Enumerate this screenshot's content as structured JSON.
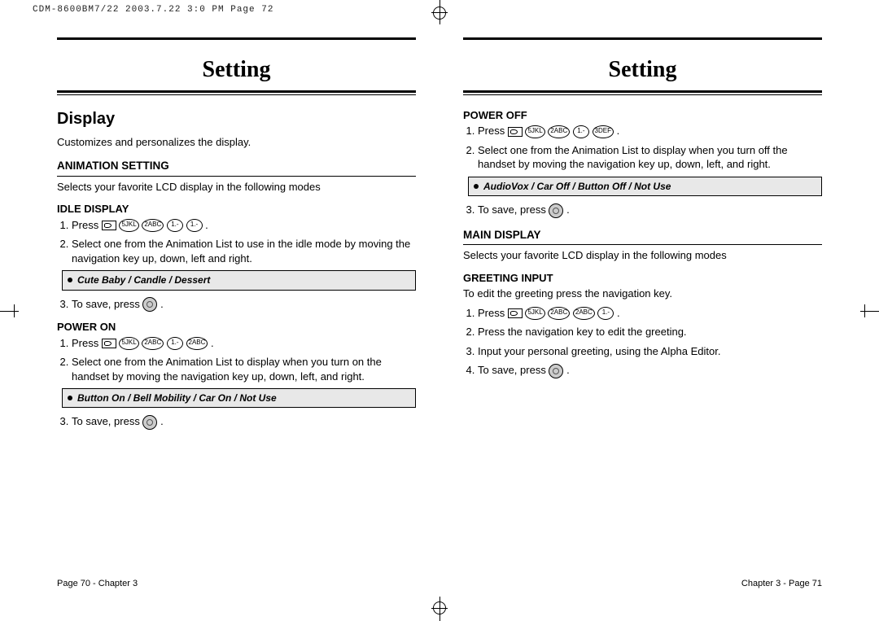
{
  "print_header": "CDM-8600BM7/22  2003.7.22  3:0 PM  Page 72",
  "chapter_title": "Setting",
  "left": {
    "h1": "Display",
    "intro": "Customizes and personalizes the display.",
    "animation_setting": {
      "heading": "ANIMATION SETTING",
      "text": "Selects your favorite LCD display in the following modes"
    },
    "idle_display": {
      "heading": "IDLE DISPLAY",
      "step1_prefix": "Press",
      "keys": [
        "5JKL",
        "2ABC",
        "1.-",
        "1.-"
      ],
      "step2": "Select one from the Animation List to use in the idle mode by moving the navigation key up, down, left and right.",
      "options": "Cute Baby / Candle / Dessert",
      "step3_prefix": "To save, press"
    },
    "power_on": {
      "heading": "POWER ON",
      "step1_prefix": "Press",
      "keys": [
        "5JKL",
        "2ABC",
        "1.-",
        "2ABC"
      ],
      "step2": "Select one from the Animation List to display when you turn on the handset by moving the navigation key up, down, left, and right.",
      "options": "Button On / Bell Mobility / Car On / Not Use",
      "step3_prefix": "To save, press"
    },
    "footer": "Page 70 - Chapter 3"
  },
  "right": {
    "power_off": {
      "heading": "POWER OFF",
      "step1_prefix": "Press",
      "keys": [
        "5JKL",
        "2ABC",
        "1.-",
        "3DEF"
      ],
      "step2": "Select one from the Animation List to display when you turn off the handset by moving the navigation key up, down, left, and right.",
      "options": "AudioVox / Car Off / Button Off / Not Use",
      "step3_prefix": "To save, press"
    },
    "main_display": {
      "heading": "MAIN DISPLAY",
      "text": "Selects your favorite LCD display in the following modes"
    },
    "greeting_input": {
      "heading": "GREETING INPUT",
      "intro": "To edit the greeting press the navigation key.",
      "step1_prefix": "Press",
      "keys": [
        "5JKL",
        "2ABC",
        "2ABC",
        "1.-"
      ],
      "step2": "Press the navigation key to edit the greeting.",
      "step3": "Input your personal greeting, using the Alpha Editor.",
      "step4_prefix": "To save, press"
    },
    "footer": "Chapter 3 - Page 71"
  }
}
